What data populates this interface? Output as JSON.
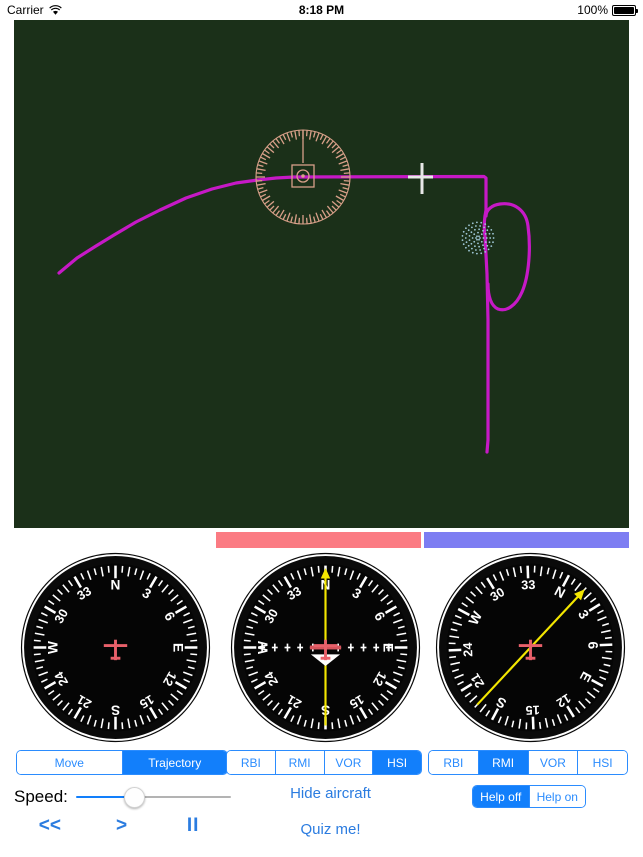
{
  "status_bar": {
    "carrier": "Carrier",
    "wifi_icon": "wifi-icon",
    "time": "8:18 PM",
    "battery_percent": "100%",
    "battery_icon": "battery-full-icon"
  },
  "map": {
    "background_color": "#1b3019",
    "trajectory_color": "#c619c6",
    "vor_station_color": "#d8a089",
    "ndb_station_color": "#9fc7d6",
    "aircraft_marker_color": "#e8e8e8",
    "aircraft_label": "aircraft-marker",
    "vor_label": "vor-station",
    "ndb_label": "ndb-station"
  },
  "bars": {
    "left_color": "#fb7b83",
    "right_color": "#7d7df2"
  },
  "dials": {
    "common": {
      "compass_labels": [
        "N",
        "3",
        "6",
        "E",
        "12",
        "15",
        "S",
        "21",
        "24",
        "W",
        "30",
        "33"
      ],
      "face_color": "#050505",
      "rim_color": "#0b0b0b",
      "tick_color": "#ffffff",
      "aircraft_symbol_color": "#e8606a",
      "needle_color": "#f3e600"
    },
    "items": [
      {
        "name": "Relative Bearing Indicator",
        "type": "RBI",
        "rotation_deg": 0,
        "needle": false,
        "cdi": false,
        "heading_label": "E"
      },
      {
        "name": "Horizontal Situation Indicator",
        "type": "HSI",
        "rotation_deg": 0,
        "needle": true,
        "needle_deg": 0,
        "cdi": true,
        "heading_label": "E"
      },
      {
        "name": "Radio Magnetic Indicator",
        "type": "RMI",
        "rotation_deg": 28,
        "needle": true,
        "needle_deg": 43,
        "cdi": false,
        "heading_label": "E"
      }
    ]
  },
  "controls": {
    "mode_segment": {
      "name": "view-mode",
      "options": [
        "Move",
        "Trajectory"
      ],
      "selected": "Trajectory"
    },
    "instrument_segment_left": {
      "name": "left-instrument",
      "options": [
        "RBI",
        "RMI",
        "VOR",
        "HSI"
      ],
      "selected": "HSI"
    },
    "instrument_segment_right": {
      "name": "right-instrument",
      "options": [
        "RBI",
        "RMI",
        "VOR",
        "HSI"
      ],
      "selected": "RMI"
    },
    "help_segment": {
      "name": "help-toggle",
      "options": [
        "Help off",
        "Help on"
      ],
      "selected": "Help off"
    },
    "speed": {
      "label": "Speed:",
      "value_percent": 38
    },
    "transport": {
      "rewind": "<<",
      "play": ">",
      "pause": "II"
    },
    "links": {
      "hide_aircraft": "Hide aircraft",
      "quiz_me": "Quiz me!"
    },
    "accent_color": "#127ffb",
    "link_color": "#2b7ce0"
  }
}
